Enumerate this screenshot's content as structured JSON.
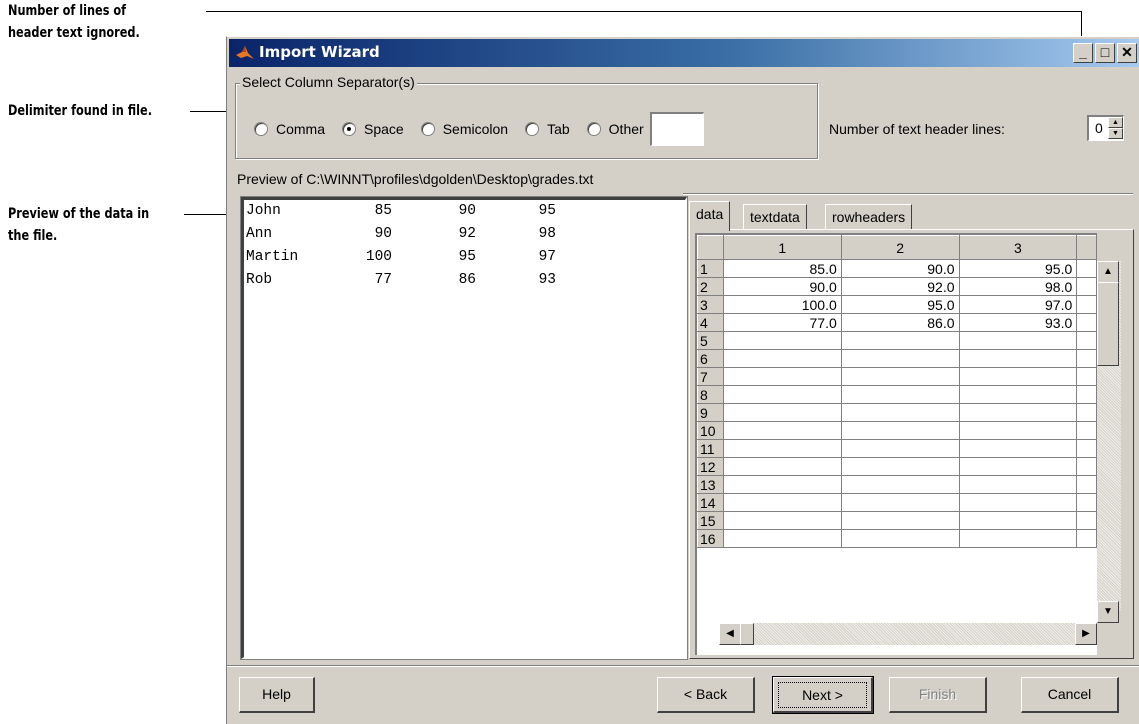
{
  "annotations": {
    "header_lines": [
      "Number of lines of",
      "header text ignored."
    ],
    "delimiter": [
      "Delimiter found in file."
    ],
    "preview": [
      "Preview of the data in",
      "the file."
    ]
  },
  "window": {
    "title": "Import Wizard",
    "controls": {
      "minimize": "_",
      "maximize": "□",
      "close": "✕"
    }
  },
  "separator": {
    "legend": "Select Column Separator(s)",
    "options": [
      {
        "label": "Comma",
        "checked": false
      },
      {
        "label": "Space",
        "checked": true
      },
      {
        "label": "Semicolon",
        "checked": false
      },
      {
        "label": "Tab",
        "checked": false
      },
      {
        "label": "Other",
        "checked": false
      }
    ],
    "other_value": ""
  },
  "header_lines": {
    "label": "Number of text header lines:",
    "value": "0"
  },
  "preview": {
    "label": "Preview of C:\\WINNT\\profiles\\dgolden\\Desktop\\grades.txt",
    "lines": [
      [
        "John",
        "85",
        "90",
        "95"
      ],
      [
        "Ann",
        "90",
        "92",
        "98"
      ],
      [
        "Martin",
        "100",
        "95",
        "97"
      ],
      [
        "Rob",
        "77",
        "86",
        "93"
      ]
    ]
  },
  "tabs": [
    {
      "label": "data",
      "active": true
    },
    {
      "label": "textdata",
      "active": false
    },
    {
      "label": "rowheaders",
      "active": false
    }
  ],
  "grid": {
    "columns": [
      "1",
      "2",
      "3"
    ],
    "row_numbers": [
      "1",
      "2",
      "3",
      "4",
      "5",
      "6",
      "7",
      "8",
      "9",
      "10",
      "11",
      "12",
      "13",
      "14",
      "15",
      "16"
    ],
    "rows": [
      [
        "85.0",
        "90.0",
        "95.0"
      ],
      [
        "90.0",
        "92.0",
        "98.0"
      ],
      [
        "100.0",
        "95.0",
        "97.0"
      ],
      [
        "77.0",
        "86.0",
        "93.0"
      ]
    ]
  },
  "buttons": {
    "help": "Help",
    "back": "< Back",
    "next": "Next >",
    "finish": "Finish",
    "cancel": "Cancel"
  }
}
